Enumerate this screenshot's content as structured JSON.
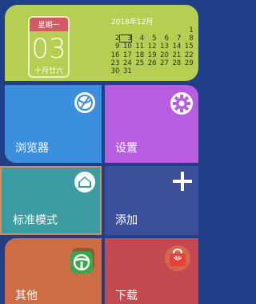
{
  "calendar": {
    "weekday": "星期一",
    "day": "03",
    "lunar": "十月廿六",
    "month_title": "2018年12月",
    "weeks": [
      [
        "",
        "",
        "",
        "",
        "",
        "",
        "1"
      ],
      [
        "2",
        "3",
        "4",
        "5",
        "6",
        "7",
        "8"
      ],
      [
        "9",
        "10",
        "11",
        "12",
        "13",
        "14",
        "15"
      ],
      [
        "16",
        "17",
        "18",
        "19",
        "20",
        "21",
        "22"
      ],
      [
        "23",
        "24",
        "25",
        "26",
        "27",
        "28",
        "29"
      ],
      [
        "30",
        "31",
        "",
        "",
        "",
        "",
        ""
      ]
    ],
    "today": "3"
  },
  "tiles": {
    "browser": {
      "label": "浏览器",
      "icon": "browser-globe-icon",
      "color": "#3c8fde"
    },
    "settings": {
      "label": "设置",
      "icon": "gear-icon",
      "color": "#b65de0"
    },
    "standard_mode": {
      "label": "标准模式",
      "icon": "home-icon",
      "color": "#3b9da2",
      "selected": true
    },
    "add": {
      "label": "添加",
      "icon": "plus-icon",
      "color": "#3c4f9a"
    },
    "other": {
      "label": "其他",
      "icon": "steering-wheel-icon",
      "color": "#cc6d46"
    },
    "download": {
      "label": "下载",
      "icon": "huawei-store-icon",
      "color": "#c44a52"
    }
  },
  "colors": {
    "background": "#203f88",
    "calendar_widget": "#b6cf52",
    "weekday_header": "#d25a63",
    "selection_border": "#de8a53"
  }
}
